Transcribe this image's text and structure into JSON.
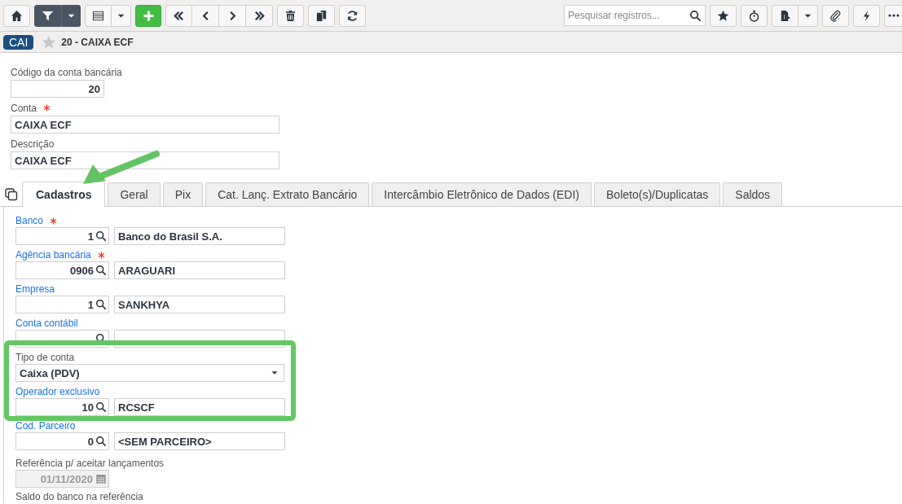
{
  "toolbar": {
    "search": {
      "placeholder": "Pesquisar registros..."
    }
  },
  "breadcrumb": {
    "badge": "CAI",
    "favorite": false,
    "title": "20 - CAIXA ECF"
  },
  "header_fields": [
    {
      "kind": "number",
      "label": "Código da conta bancária",
      "value": "20"
    },
    {
      "kind": "text",
      "label": "Conta",
      "required": true,
      "value": "CAIXA ECF"
    },
    {
      "kind": "text",
      "label": "Descrição",
      "value": "CAIXA ECF"
    }
  ],
  "tabs": [
    {
      "label": "Cadastros",
      "selected": true
    },
    {
      "label": "Geral",
      "selected": false
    },
    {
      "label": "Pix",
      "selected": false
    },
    {
      "label": "Cat. Lanç. Extrato Bancário",
      "selected": false
    },
    {
      "label": "Intercâmbio Eletrônico de Dados (EDI)",
      "selected": false
    },
    {
      "label": "Boleto(s)/Duplicatas",
      "selected": false
    },
    {
      "label": "Saldos",
      "selected": false
    }
  ],
  "fields": [
    {
      "kind": "lookup",
      "label": "Banco",
      "linked": true,
      "required": true,
      "code": "1",
      "description": "Banco do Brasil S.A."
    },
    {
      "kind": "lookup",
      "label": "Agência bancária",
      "linked": true,
      "required": true,
      "code": "0906",
      "description": "ARAGUARI"
    },
    {
      "kind": "lookup",
      "label": "Empresa",
      "linked": true,
      "code": "1",
      "description": "SANKHYA"
    },
    {
      "kind": "lookup",
      "label": "Conta contábil",
      "linked": true
    },
    {
      "kind": "select",
      "label": "Tipo de conta",
      "linked": false,
      "highlighted": true,
      "value": "Caixa (PDV)"
    },
    {
      "kind": "lookup",
      "label": "Operador exclusivo",
      "linked": true,
      "highlighted": true,
      "code": "10",
      "description": "RCSCF"
    },
    {
      "kind": "lookup",
      "label": "Cod. Parceiro",
      "linked": true,
      "code": "0",
      "description": "<SEM PARCEIRO>"
    },
    {
      "kind": "date",
      "label": "Referência p/ aceitar lançamentos",
      "linked": false,
      "disabled": true,
      "value": "01/11/2020"
    },
    {
      "kind": "label",
      "label": "Saldo do banco na referência",
      "linked": false
    }
  ]
}
